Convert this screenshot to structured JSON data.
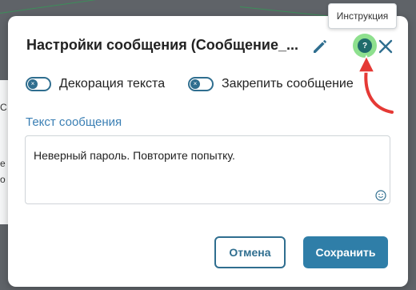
{
  "background": {
    "side_chars": [
      "С",
      "е",
      "о"
    ]
  },
  "tooltip": {
    "text": "Инструкция"
  },
  "dialog": {
    "title": "Настройки сообщения (Сообщение_...",
    "icons": {
      "edit": "pencil-icon",
      "help": "help-icon",
      "close": "close-icon",
      "emoji": "emoji-icon",
      "annotation": "red-arrow-icon"
    },
    "help_glyph": "?",
    "toggles": [
      {
        "label": "Декорация текста",
        "state": "off"
      },
      {
        "label": "Закрепить сообщение",
        "state": "off"
      }
    ],
    "toggle_glyph": "×",
    "message_field": {
      "label": "Текст сообщения",
      "value": "Неверный пароль. Повторите попытку."
    },
    "buttons": {
      "cancel": "Отмена",
      "save": "Сохранить"
    }
  },
  "colors": {
    "accent": "#2f6e8f",
    "primary_button": "#2f7ea8",
    "link_label": "#3a7fb4",
    "help_highlight": "#8ee08e",
    "annotation_arrow": "#e53935"
  }
}
